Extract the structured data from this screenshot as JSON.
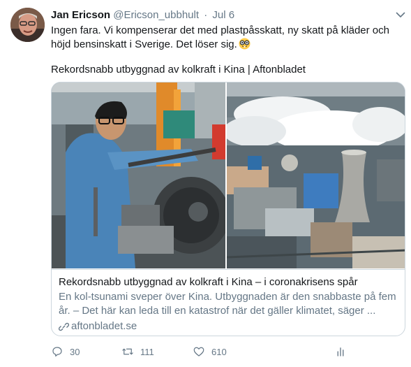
{
  "author": {
    "name": "Jan Ericson",
    "handle": "@Ericson_ubbhult",
    "separator": "·",
    "date": "Jul 6"
  },
  "tweet": {
    "line1": "Ingen fara. Vi kompenserar det med plastpåsskatt, ny skatt på kläder och",
    "line2": "höjd bensinskatt i Sverige. Det löser sig.",
    "emoji_icon": "nerd-face-emoji",
    "link_title": "Rekordsnabb utbyggnad av kolkraft i Kina | Aftonbladet"
  },
  "card": {
    "title": "Rekordsnabb utbyggnad av kolkraft i Kina – i coronakrisens spår",
    "desc_line1": "En kol-tsunami sveper över Kina. Utbyggnaden är den snabbaste på fem",
    "desc_line2": "år. – Det här kan leda till en katastrof när det gäller klimatet, säger ...",
    "domain": "aftonbladet.se",
    "domain_icon": "link-icon"
  },
  "actions": {
    "reply_count": "30",
    "retweet_count": "111",
    "like_count": "610",
    "icons": [
      "reply-icon",
      "retweet-icon",
      "like-icon",
      "analytics-icon"
    ]
  },
  "colors": {
    "text": "#14171a",
    "secondary": "#657786",
    "border": "#ccd6dd"
  }
}
